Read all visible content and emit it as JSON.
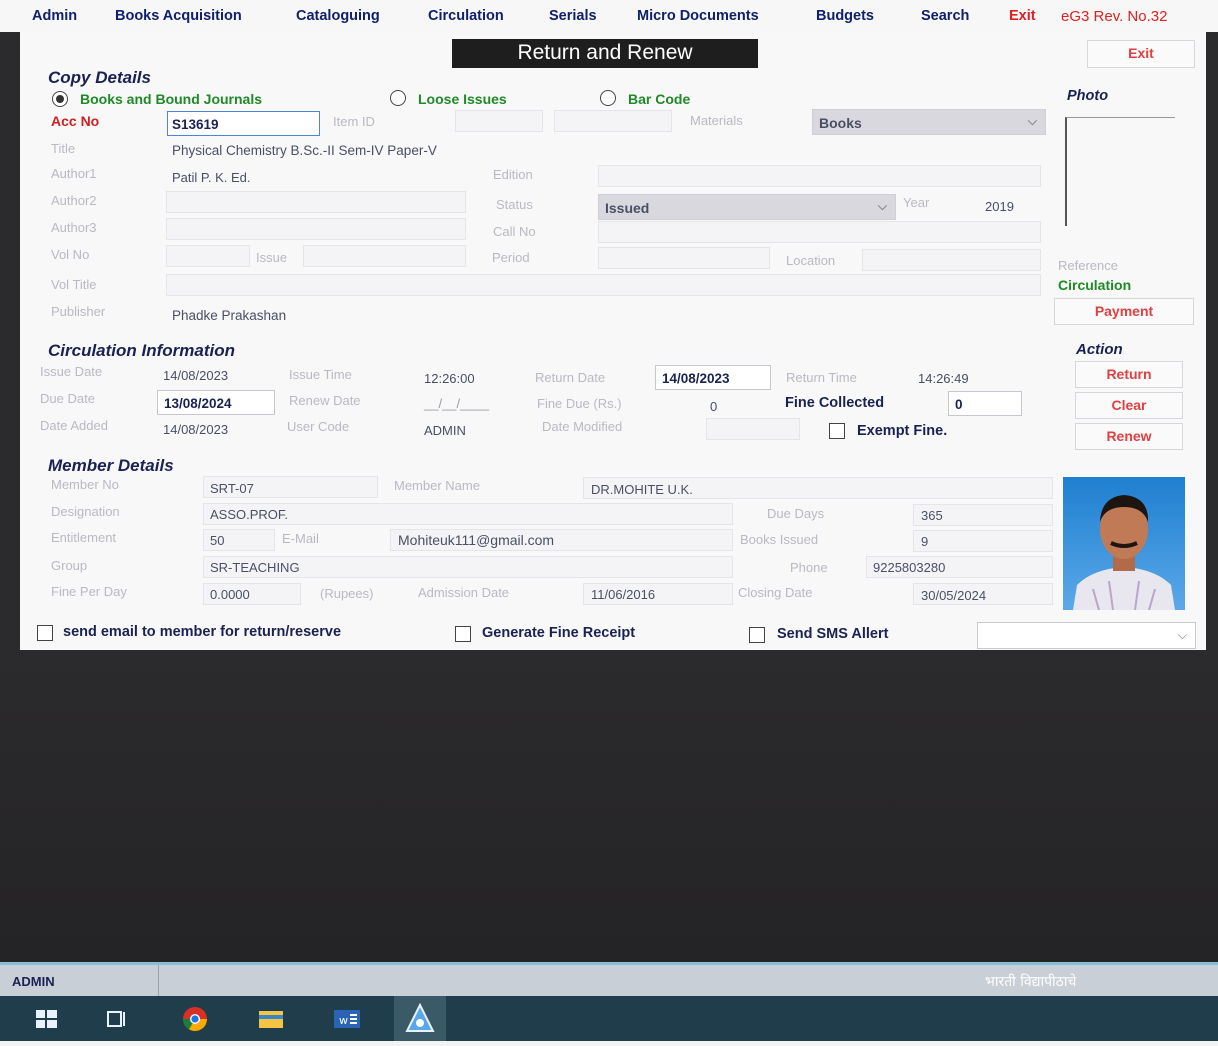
{
  "menu": {
    "items": [
      "Admin",
      "Books Acquisition",
      "Cataloguing",
      "Circulation",
      "Serials",
      "Micro Documents",
      "Budgets",
      "Search"
    ],
    "exit": "Exit",
    "version": "eG3 Rev. No.32"
  },
  "window": {
    "title": "Return and Renew",
    "exit_button": "Exit"
  },
  "copy": {
    "section": "Copy Details",
    "radios": {
      "books": "Books and Bound Journals",
      "loose": "Loose Issues",
      "barcode": "Bar Code"
    },
    "acc_no_label": "Acc No",
    "acc_no": "S13619",
    "item_id_label": "Item ID",
    "materials_label": "Materials",
    "materials": "Books",
    "title_label": "Title",
    "title": "Physical Chemistry B.Sc.-II Sem-IV Paper-V",
    "author1_label": "Author1",
    "author1": "Patil P. K. Ed.",
    "edition_label": "Edition",
    "author2_label": "Author2",
    "status_label": "Status",
    "status": "Issued",
    "year_label": "Year",
    "year": "2019",
    "author3_label": "Author3",
    "call_no_label": "Call No",
    "vol_no_label": "Vol No",
    "issue_label": "Issue",
    "period_label": "Period",
    "location_label": "Location",
    "vol_title_label": "Vol Title",
    "publisher_label": "Publisher",
    "publisher": "Phadke Prakashan"
  },
  "side": {
    "photo_label": "Photo",
    "reference": "Reference",
    "circulation": "Circulation",
    "payment": "Payment",
    "action_label": "Action",
    "return": "Return",
    "clear": "Clear",
    "renew": "Renew"
  },
  "circ": {
    "section": "Circulation Information",
    "issue_date_label": "Issue Date",
    "issue_date": "14/08/2023",
    "issue_time_label": "Issue Time",
    "issue_time": "12:26:00",
    "return_date_label": "Return Date",
    "return_date": "14/08/2023",
    "return_time_label": "Return Time",
    "return_time": "14:26:49",
    "due_date_label": "Due Date",
    "due_date": "13/08/2024",
    "renew_date_label": "Renew Date",
    "renew_date": "__/__/____",
    "fine_due_label": "Fine Due (Rs.)",
    "fine_due": "0",
    "fine_collected_label": "Fine Collected",
    "fine_collected": "0",
    "date_added_label": "Date Added",
    "date_added": "14/08/2023",
    "user_code_label": "User Code",
    "user_code": "ADMIN",
    "date_modified_label": "Date Modified",
    "exempt_label": "Exempt Fine."
  },
  "member": {
    "section": "Member Details",
    "member_no_label": "Member No",
    "member_no": "SRT-07",
    "member_name_label": "Member Name",
    "member_name": "DR.MOHITE U.K.",
    "designation_label": "Designation",
    "designation": "ASSO.PROF.",
    "due_days_label": "Due Days",
    "due_days": "365",
    "entitlement_label": "Entitlement",
    "entitlement": "50",
    "email_label": "E-Mail",
    "email": "Mohiteuk111@gmail.com",
    "books_issued_label": "Books Issued",
    "books_issued": "9",
    "group_label": "Group",
    "group": "SR-TEACHING",
    "phone_label": "Phone",
    "phone": "9225803280",
    "fine_per_day_label": "Fine Per Day",
    "fine_per_day": "0.0000",
    "rupees_label": "(Rupees)",
    "admission_date_label": "Admission Date",
    "admission_date": "11/06/2016",
    "closing_date_label": "Closing Date",
    "closing_date": "30/05/2024"
  },
  "options": {
    "send_email": "send email to member for return/reserve",
    "fine_receipt": "Generate Fine Receipt",
    "sms": "Send SMS Allert"
  },
  "status": {
    "user": "ADMIN",
    "org": "भारती विद्यापीठाचे"
  },
  "taskbar_icons": [
    "windows-icon",
    "task-view-icon",
    "chrome-icon",
    "file-explorer-icon",
    "word-icon",
    "library-app-icon"
  ]
}
